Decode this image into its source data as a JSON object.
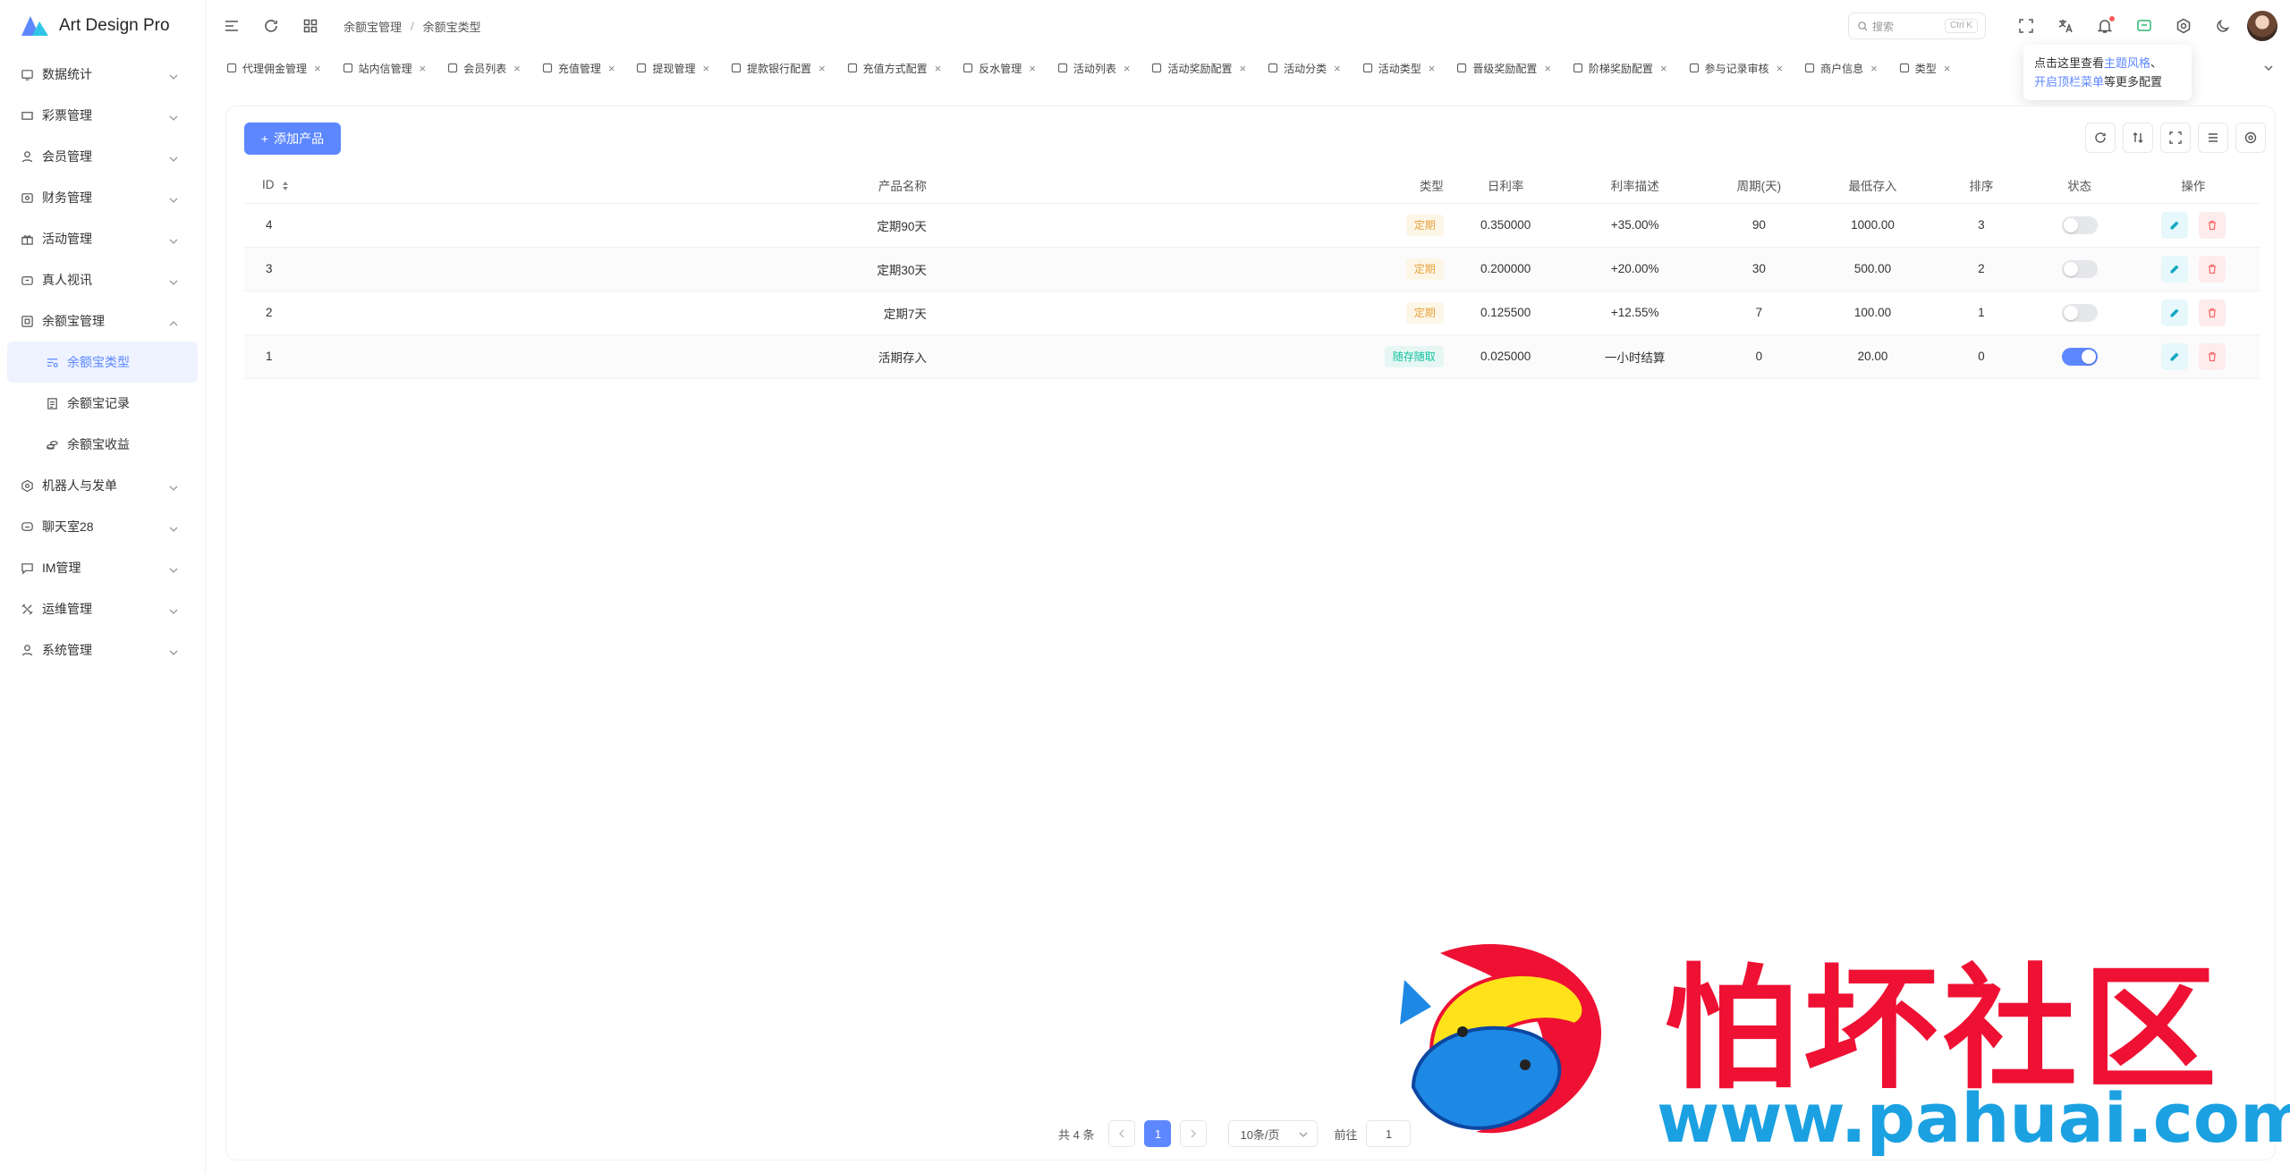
{
  "app": {
    "name": "Art Design Pro"
  },
  "colors": {
    "primary": "#5d87ff",
    "danger": "#f56c6c",
    "cyan": "#13c2c2"
  },
  "sidebar": {
    "items": [
      {
        "label": "数据统计",
        "icon": "monitor-icon"
      },
      {
        "label": "彩票管理",
        "icon": "ticket-icon"
      },
      {
        "label": "会员管理",
        "icon": "user-icon"
      },
      {
        "label": "财务管理",
        "icon": "wallet-icon"
      },
      {
        "label": "活动管理",
        "icon": "gift-icon"
      },
      {
        "label": "真人视讯",
        "icon": "video-icon"
      },
      {
        "label": "余额宝管理",
        "icon": "safe-icon",
        "expanded": true,
        "children": [
          {
            "label": "余额宝类型",
            "icon": "filter-icon",
            "active": true
          },
          {
            "label": "余额宝记录",
            "icon": "document-icon"
          },
          {
            "label": "余额宝收益",
            "icon": "coins-icon"
          }
        ]
      },
      {
        "label": "机器人与发单",
        "icon": "robot-icon"
      },
      {
        "label": "聊天室28",
        "icon": "chat-icon"
      },
      {
        "label": "IM管理",
        "icon": "message-icon"
      },
      {
        "label": "运维管理",
        "icon": "tools-icon"
      },
      {
        "label": "系统管理",
        "icon": "user-icon"
      }
    ]
  },
  "header": {
    "breadcrumb": [
      "余额宝管理",
      "余额宝类型"
    ],
    "search_placeholder": "搜索",
    "search_shortcut": "Ctrl K"
  },
  "tabs": [
    "代理佣金管理",
    "站内信管理",
    "会员列表",
    "充值管理",
    "提现管理",
    "提款银行配置",
    "充值方式配置",
    "反水管理",
    "活动列表",
    "活动奖励配置",
    "活动分类",
    "活动类型",
    "晋级奖励配置",
    "阶梯奖励配置",
    "参与记录审核",
    "商户信息",
    "类型"
  ],
  "tooltip": {
    "line1_prefix": "点击这里查看",
    "line1_link": "主题风格",
    "line1_suffix": "、",
    "line2_link": "开启顶栏菜单",
    "line2_suffix": "等更多配置"
  },
  "toolbar": {
    "add_label": "添加产品"
  },
  "table": {
    "columns": [
      "ID",
      "产品名称",
      "类型",
      "日利率",
      "利率描述",
      "周期(天)",
      "最低存入",
      "排序",
      "状态",
      "操作"
    ],
    "rows": [
      {
        "id": "4",
        "name": "定期90天",
        "type": "定期",
        "type_kind": "fixed",
        "daily_rate": "0.350000",
        "rate_desc": "+35.00%",
        "period": "90",
        "min_deposit": "1000.00",
        "sort": "3",
        "enabled": false
      },
      {
        "id": "3",
        "name": "定期30天",
        "type": "定期",
        "type_kind": "fixed",
        "daily_rate": "0.200000",
        "rate_desc": "+20.00%",
        "period": "30",
        "min_deposit": "500.00",
        "sort": "2",
        "enabled": false
      },
      {
        "id": "2",
        "name": "定期7天",
        "type": "定期",
        "type_kind": "fixed",
        "daily_rate": "0.125500",
        "rate_desc": "+12.55%",
        "period": "7",
        "min_deposit": "100.00",
        "sort": "1",
        "enabled": false
      },
      {
        "id": "1",
        "name": "活期存入",
        "type": "随存随取",
        "type_kind": "flex",
        "daily_rate": "0.025000",
        "rate_desc": "一小时结算",
        "period": "0",
        "min_deposit": "20.00",
        "sort": "0",
        "enabled": true
      }
    ]
  },
  "pagination": {
    "total": "共 4 条",
    "current": "1",
    "page_size": "10条/页",
    "goto_label": "前往",
    "goto_value": "1"
  },
  "watermark": {
    "text": "怕坏社区",
    "url": "www.pahuai.com"
  }
}
